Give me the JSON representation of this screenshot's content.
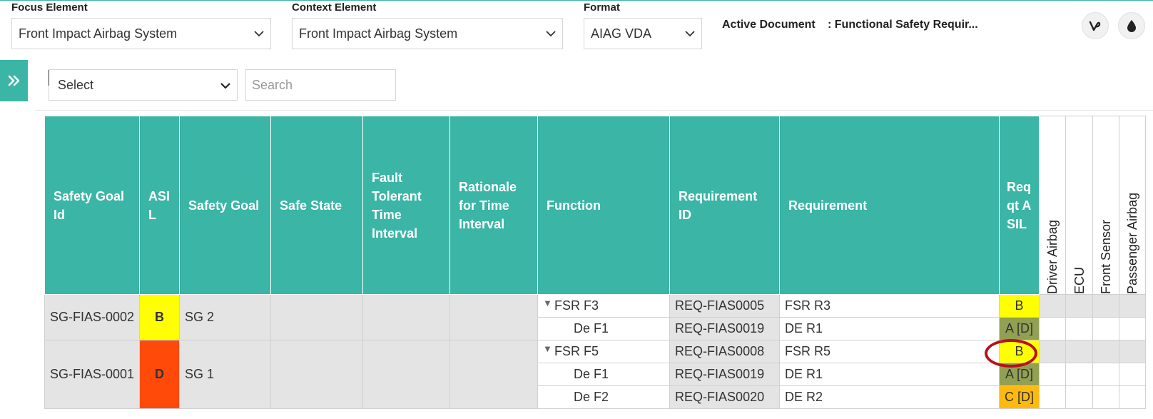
{
  "toolbar": {
    "focus_label": "Focus Element",
    "focus_value": "Front Impact Airbag System",
    "context_label": "Context Element",
    "context_value": "Front Impact Airbag System",
    "format_label": "Format",
    "format_value": "AIAG VDA",
    "active_doc_label": "Active Document",
    "active_doc_value": ": Functional Safety Requir..."
  },
  "filter": {
    "select_value": "Select",
    "search_placeholder": "Search"
  },
  "table": {
    "headers": {
      "sg_id": "Safety Goal Id",
      "asil": "ASIL",
      "safety_goal": "Safety Goal",
      "safe_state": "Safe State",
      "ftti": "Fault Tolerant Time Interval",
      "rationale": "Rationale for Time Interval",
      "function": "Function",
      "req_id": "Requirement ID",
      "requirement": "Requirement",
      "req_asil": "Req qt ASIL",
      "driver_airbag": "Driver Airbag",
      "ecu": "ECU",
      "front_sensor": "Front Sensor",
      "passenger_airbag": "Passenger Airbag"
    },
    "goals": [
      {
        "id": "SG-FIAS-0002",
        "asil": "B",
        "name": "SG 2",
        "rows": [
          {
            "function": "FSR F3",
            "req_id": "REQ-FIAS0005",
            "requirement": "FSR R3",
            "req_asil": "B"
          },
          {
            "function": "De F1",
            "req_id": "REQ-FIAS0019",
            "requirement": "DE R1",
            "req_asil": "A [D]"
          }
        ]
      },
      {
        "id": "SG-FIAS-0001",
        "asil": "D",
        "name": "SG 1",
        "rows": [
          {
            "function": "FSR F5",
            "req_id": "REQ-FIAS0008",
            "requirement": "FSR R5",
            "req_asil": "B"
          },
          {
            "function": "De F1",
            "req_id": "REQ-FIAS0019",
            "requirement": "DE R1",
            "req_asil": "A [D]"
          },
          {
            "function": "De F2",
            "req_id": "REQ-FIAS0020",
            "requirement": "DE R2",
            "req_asil": "C [D]"
          }
        ]
      }
    ]
  },
  "colors": {
    "accent": "#3bb5a6",
    "asil_b": "#ffff00",
    "asil_d": "#ff4a0a",
    "asil_a": "#91a052",
    "asil_c": "#ffb90f",
    "highlight_ring": "#b5121b"
  },
  "icons": {
    "vine": "vine-icon",
    "drop": "water-drop-icon",
    "expand": "double-chevron-right-icon"
  }
}
